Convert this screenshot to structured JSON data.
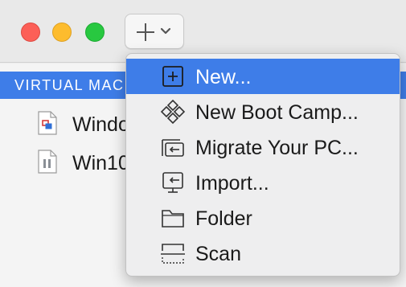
{
  "sidebar": {
    "section_header": "VIRTUAL MAC",
    "vms": [
      {
        "name": "Windo",
        "icon": "windows-vm-doc-icon"
      },
      {
        "name": "Win10",
        "icon": "paused-vm-doc-icon"
      }
    ]
  },
  "add_menu": {
    "items": [
      {
        "label": "New...",
        "icon": "plus-box-icon",
        "selected": true
      },
      {
        "label": "New Boot Camp...",
        "icon": "boot-camp-icon",
        "selected": false
      },
      {
        "label": "Migrate Your PC...",
        "icon": "migrate-pc-icon",
        "selected": false
      },
      {
        "label": "Import...",
        "icon": "import-icon",
        "selected": false
      },
      {
        "label": "Folder",
        "icon": "folder-icon",
        "selected": false
      },
      {
        "label": "Scan",
        "icon": "scan-icon",
        "selected": false
      }
    ]
  },
  "colors": {
    "selection_blue": "#3e7de8",
    "close": "#fc5f57",
    "minimize": "#fdbc2e",
    "maximize": "#28c840"
  }
}
